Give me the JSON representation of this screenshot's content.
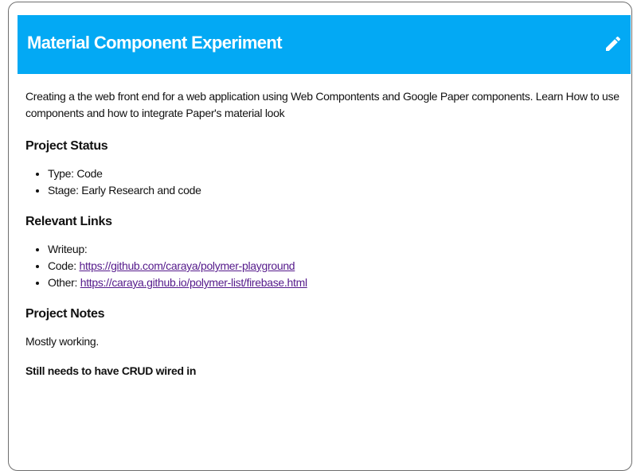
{
  "header": {
    "title": "Material Component Experiment",
    "edit_icon": "pencil-icon",
    "background_color": "#03a9f4"
  },
  "description": "Creating a the web front end for a web application using Web Compontents and Google Paper components. Learn How to use components and how to integrate Paper's material look",
  "project_status": {
    "heading": "Project Status",
    "items": [
      {
        "label": "Type:",
        "value": "Code"
      },
      {
        "label": "Stage:",
        "value": "Early Research and code"
      }
    ]
  },
  "relevant_links": {
    "heading": "Relevant Links",
    "items": [
      {
        "label": "Writeup:",
        "url": ""
      },
      {
        "label": "Code:",
        "url": "https://github.com/caraya/polymer-playground"
      },
      {
        "label": "Other:",
        "url": "https://caraya.github.io/polymer-list/firebase.html"
      }
    ]
  },
  "project_notes": {
    "heading": "Project Notes",
    "note": "Mostly working.",
    "bold_note": "Still needs to have CRUD wired in"
  },
  "link_color": "#551a8b"
}
